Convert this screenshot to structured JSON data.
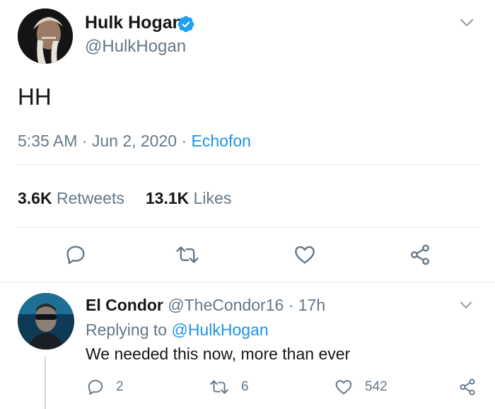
{
  "tweet": {
    "author": {
      "name": "Hulk Hogan",
      "handle": "@HulkHogan",
      "verified": true
    },
    "text": "HH",
    "time": "5:35 AM",
    "date": "Jun 2, 2020",
    "source": "Echofon",
    "separator": "·",
    "retweets_count": "3.6K",
    "retweets_label": "Retweets",
    "likes_count": "13.1K",
    "likes_label": "Likes",
    "actions": [
      "reply-icon",
      "retweet-icon",
      "like-icon",
      "share-icon"
    ]
  },
  "reply": {
    "author": {
      "name": "El Condor",
      "handle": "@TheCondor16",
      "age": "17h"
    },
    "separator": "·",
    "replying_prefix": "Replying to",
    "replying_to": "@HulkHogan",
    "text": "We needed this now, more than ever",
    "reply_count": "2",
    "retweet_count": "6",
    "like_count": "542"
  },
  "colors": {
    "text": "#14171a",
    "secondary": "#657786",
    "link": "#1b95e0",
    "verified": "#1da1f2",
    "divider": "#e1e8ed"
  }
}
